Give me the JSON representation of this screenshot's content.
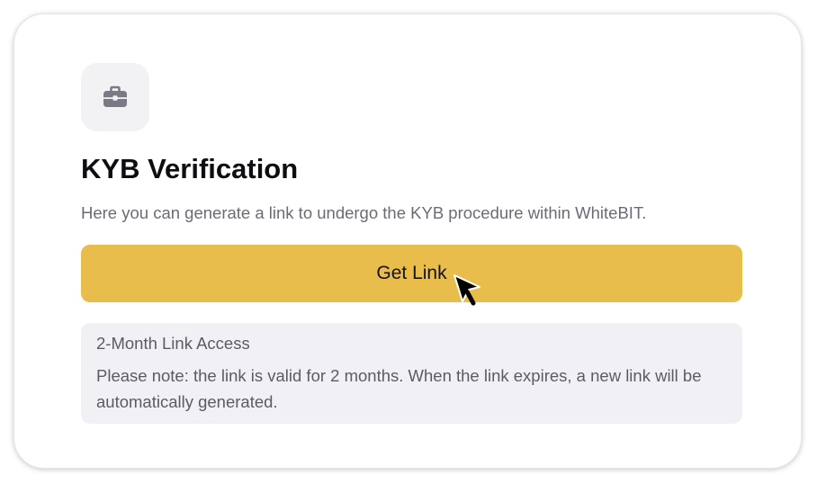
{
  "card": {
    "icon": "briefcase-icon",
    "title": "KYB Verification",
    "subtitle": "Here you can generate a link to undergo the KYB procedure within WhiteBIT.",
    "button_label": "Get Link"
  },
  "notice": {
    "title": "2-Month Link Access",
    "body": "Please note: the link is valid for 2 months. When the link expires, a new link will be automatically generated."
  },
  "colors": {
    "accent": "#e8bd4b",
    "notice_bg": "#f1f1f5",
    "icon_tile_bg": "#f2f2f5",
    "text_primary": "#0d0d12",
    "text_secondary": "#6b6b78"
  }
}
